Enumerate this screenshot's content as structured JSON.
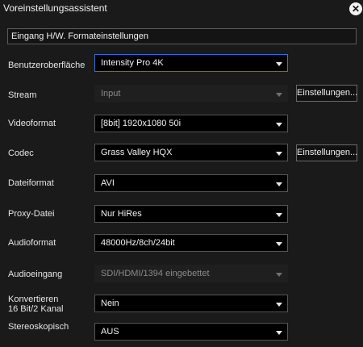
{
  "window": {
    "title": "Voreinstellungsassistent",
    "close_icon": "close-icon"
  },
  "section": {
    "title": "Eingang H/W. Formateinstellungen"
  },
  "fields": {
    "benutzeroberflaeche": {
      "label": "Benutzeroberfläche",
      "value": "Intensity Pro 4K"
    },
    "stream": {
      "label": "Stream",
      "value": "Input",
      "button": "Einstellungen..."
    },
    "videoformat": {
      "label": "Videoformat",
      "value": "[8bit] 1920x1080 50i"
    },
    "codec": {
      "label": "Codec",
      "value": "Grass Valley HQX",
      "button": "Einstellungen..."
    },
    "dateiformat": {
      "label": "Dateiformat",
      "value": "AVI"
    },
    "proxy": {
      "label": "Proxy-Datei",
      "value": "Nur HiRes"
    },
    "audioformat": {
      "label": "Audioformat",
      "value": "48000Hz/8ch/24bit"
    },
    "audioeingang": {
      "label": "Audioeingang",
      "value": "SDI/HDMI/1394 eingebettet"
    },
    "konvertieren": {
      "label_line1": "Konvertieren",
      "label_line2": "16 Bit/2 Kanal",
      "value": "Nein"
    },
    "stereoskopisch": {
      "label": "Stereoskopisch",
      "value": "AUS"
    }
  },
  "colors": {
    "background": "#1a1a1a",
    "focus_border": "#3a6fd0"
  }
}
